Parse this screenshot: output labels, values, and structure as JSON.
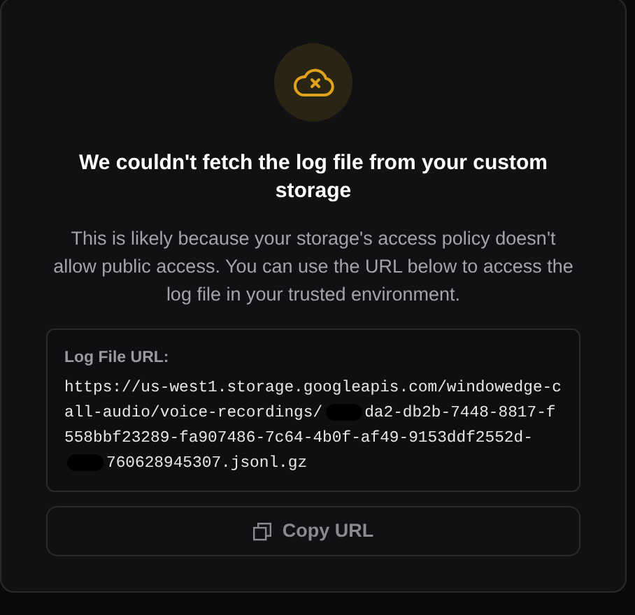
{
  "title": "We couldn't fetch the log file from your custom storage",
  "description": "This is likely because your storage's access policy doesn't allow public access. You can use the URL below to access the log file in your trusted environment.",
  "url_box": {
    "label": "Log File URL:",
    "segments": [
      {
        "kind": "text",
        "text": "https://us-west1.storage.googleapis.com/windowedge-call-audio/voice-recordings/"
      },
      {
        "kind": "redacted"
      },
      {
        "kind": "text",
        "text": "da2-db2b-7448-8817-f558bbf23289-fa907486-7c64-4b0f-af49-9153ddf2552d-"
      },
      {
        "kind": "redacted"
      },
      {
        "kind": "text",
        "text": "760628945307.jsonl.gz"
      }
    ]
  },
  "copy_button": {
    "label": "Copy URL",
    "disabled": true
  }
}
